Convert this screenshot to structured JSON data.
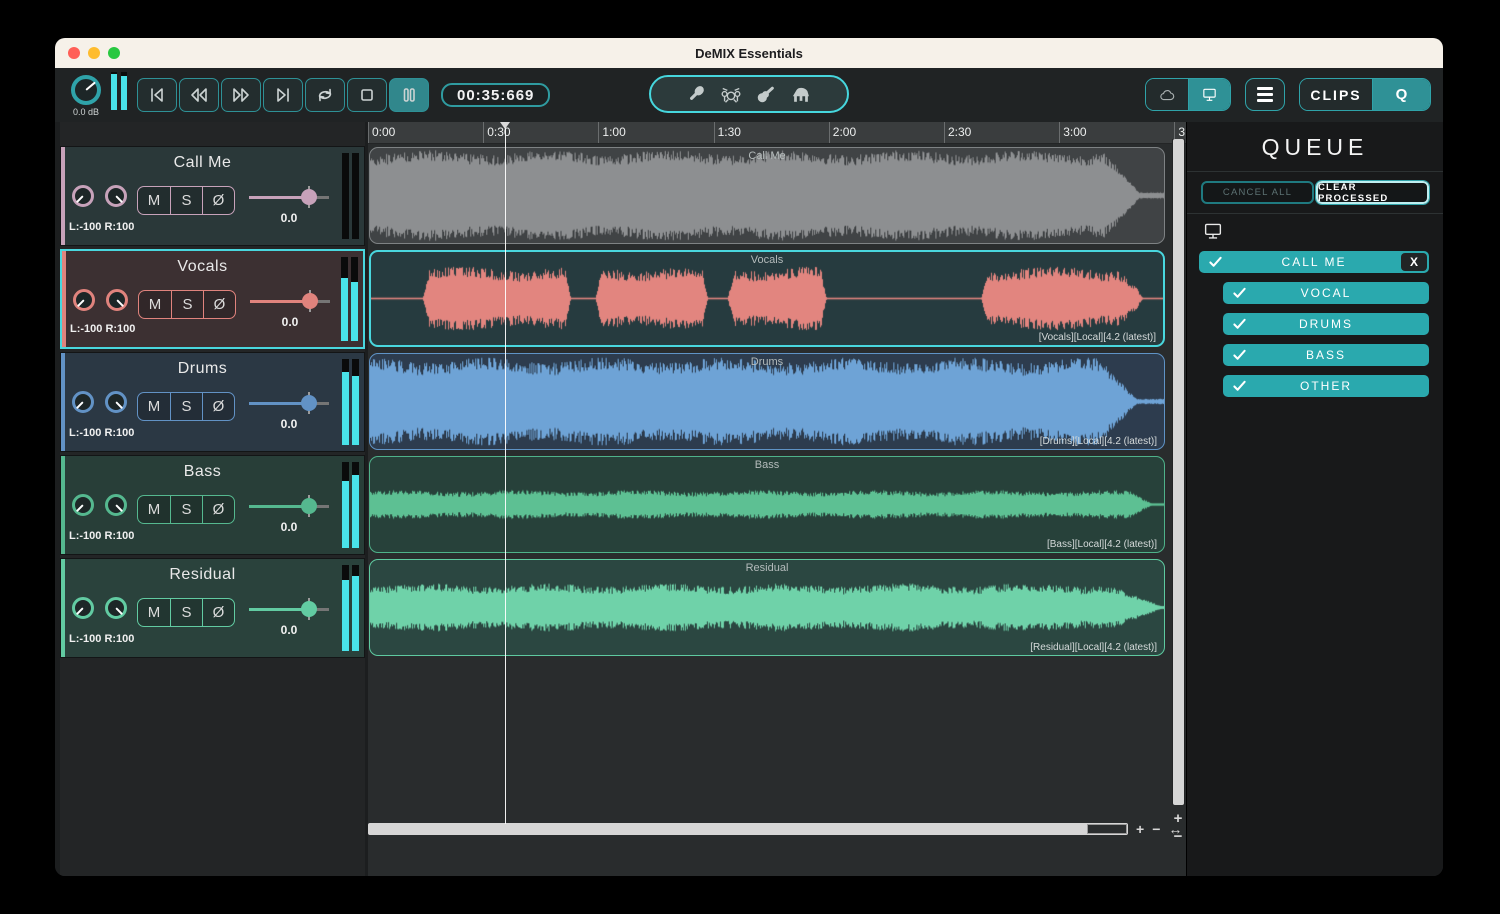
{
  "window": {
    "title": "DeMIX Essentials"
  },
  "toolbar": {
    "gain_label": "0.0 dB",
    "time_display": "00:35:669",
    "transport_icons": [
      "skip-start",
      "rewind",
      "fast-forward",
      "skip-end",
      "loop",
      "stop",
      "pause"
    ],
    "active_transport": "pause",
    "instrument_icons": [
      "microphone",
      "drums",
      "guitar",
      "piano"
    ],
    "clips_label": "CLIPS",
    "queue_label": "Q",
    "master_meters": [
      0.95,
      0.9
    ]
  },
  "ruler": {
    "ticks": [
      {
        "label": "0:00"
      },
      {
        "label": "0:30"
      },
      {
        "label": "1:00"
      },
      {
        "label": "1:30"
      },
      {
        "label": "2:00"
      },
      {
        "label": "2:30"
      },
      {
        "label": "3:00"
      },
      {
        "label": "3"
      }
    ],
    "seconds_per_tick": 30
  },
  "playhead": {
    "seconds": 35.669
  },
  "tracks": [
    {
      "name": "Call Me",
      "pan_label": "L:-100 R:100",
      "mute_label": "M",
      "solo_label": "S",
      "phase_label": "Ø",
      "volume_label": "0.0",
      "accent": "#c7a2ba",
      "header_bg": "#2a3839",
      "selected": false,
      "meters": [
        0,
        0
      ],
      "clip": {
        "title": "Call Me",
        "tag": "",
        "bg": "#404345",
        "border": "#7e8284",
        "wave": {
          "color": "#8d8f91",
          "amp": [
            0.55,
            0.95
          ],
          "fade": [
            0.925,
            0.968
          ],
          "centerline": false,
          "seed": 11
        }
      }
    },
    {
      "name": "Vocals",
      "pan_label": "L:-100 R:100",
      "mute_label": "M",
      "solo_label": "S",
      "phase_label": "Ø",
      "volume_label": "0.0",
      "accent": "#e0837d",
      "header_bg": "#3c3032",
      "selected": true,
      "meters": [
        0.75,
        0.7
      ],
      "clip": {
        "title": "Vocals",
        "tag": "[Vocals][Local][4.2 (latest)]",
        "bg": "#263b3f",
        "border": "#49d7de",
        "wave": {
          "color": "#e2857f",
          "amp": [
            0.28,
            0.68
          ],
          "segments": [
            [
              0.065,
              0.252
            ],
            [
              0.283,
              0.425
            ],
            [
              0.45,
              0.575
            ],
            [
              0.77,
              0.975
            ]
          ],
          "fade": [
            0.945,
            0.978
          ],
          "centerline": true,
          "seed": 22
        }
      }
    },
    {
      "name": "Drums",
      "pan_label": "L:-100 R:100",
      "mute_label": "M",
      "solo_label": "S",
      "phase_label": "Ø",
      "volume_label": "0.0",
      "accent": "#6292c5",
      "header_bg": "#2b3844",
      "selected": false,
      "meters": [
        0.85,
        0.8
      ],
      "clip": {
        "title": "Drums",
        "tag": "[Drums][Local][4.2 (latest)]",
        "bg": "#2d3c4e",
        "border": "#5f93c6",
        "wave": {
          "color": "#6ea3d6",
          "amp": [
            0.45,
            0.92
          ],
          "fade": [
            0.92,
            0.965
          ],
          "centerline": false,
          "seed": 33
        }
      }
    },
    {
      "name": "Bass",
      "pan_label": "L:-100 R:100",
      "mute_label": "M",
      "solo_label": "S",
      "phase_label": "Ø",
      "volume_label": "0.0",
      "accent": "#55b88f",
      "header_bg": "#283e38",
      "selected": false,
      "meters": [
        0.78,
        0.85
      ],
      "clip": {
        "title": "Bass",
        "tag": "[Bass][Local][4.2 (latest)]",
        "bg": "#27413a",
        "border": "#4fb28a",
        "wave": {
          "color": "#5dc093",
          "amp": [
            0.13,
            0.3
          ],
          "fade": [
            0.955,
            0.985
          ],
          "centerline": true,
          "seed": 44
        }
      }
    },
    {
      "name": "Residual",
      "pan_label": "L:-100 R:100",
      "mute_label": "M",
      "solo_label": "S",
      "phase_label": "Ø",
      "volume_label": "0.0",
      "accent": "#62cba2",
      "header_bg": "#2a423c",
      "selected": false,
      "meters": [
        0.82,
        0.87
      ],
      "clip": {
        "title": "Residual",
        "tag": "[Residual][Local][4.2 (latest)]",
        "bg": "#2b4741",
        "border": "#5ecaa0",
        "wave": {
          "color": "#6fd2a9",
          "amp": [
            0.22,
            0.5
          ],
          "fade": [
            0.93,
            0.995
          ],
          "centerline": true,
          "seed": 55
        }
      }
    }
  ],
  "queue": {
    "title": "QUEUE",
    "cancel_all_label": "CANCEL ALL",
    "clear_processed_label": "CLEAR PROCESSED",
    "job": {
      "name": "CALL ME",
      "close_label": "X",
      "checked": true,
      "stems": [
        {
          "label": "VOCAL"
        },
        {
          "label": "DRUMS"
        },
        {
          "label": "BASS"
        },
        {
          "label": "OTHER"
        }
      ]
    }
  },
  "colors": {
    "accent_teal": "#46d6dd",
    "queue_teal": "#2aa9ae",
    "meter_cyan": "#49e3ea"
  }
}
